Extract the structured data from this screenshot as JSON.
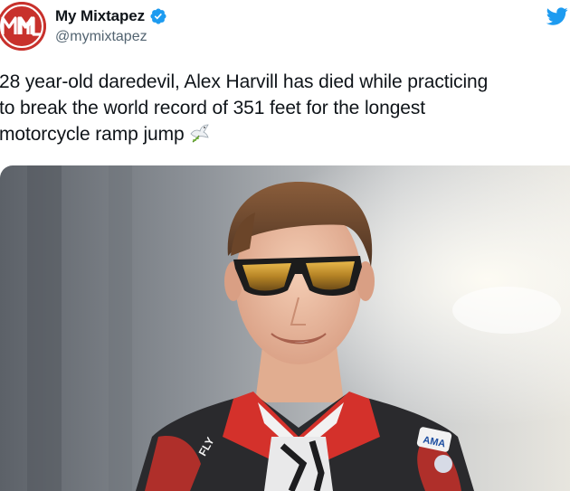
{
  "account": {
    "display_name": "My Mixtapez",
    "handle": "@mymixtapez",
    "avatar_letters": "MM",
    "verified": true,
    "avatar_color": "#c8312c"
  },
  "tweet": {
    "text": "28 year-old daredevil, Alex Harvill has died while practicing\nto break the world record of 351 feet for the longest\nmotorcycle ramp jump",
    "emoji": "dove-icon"
  },
  "media": {
    "type": "photo",
    "jersey_brand": "FLY",
    "jersey_badge": "AMA"
  },
  "colors": {
    "twitter_blue": "#1d9bf0",
    "text": "#0f1419",
    "secondary_text": "#536471"
  }
}
